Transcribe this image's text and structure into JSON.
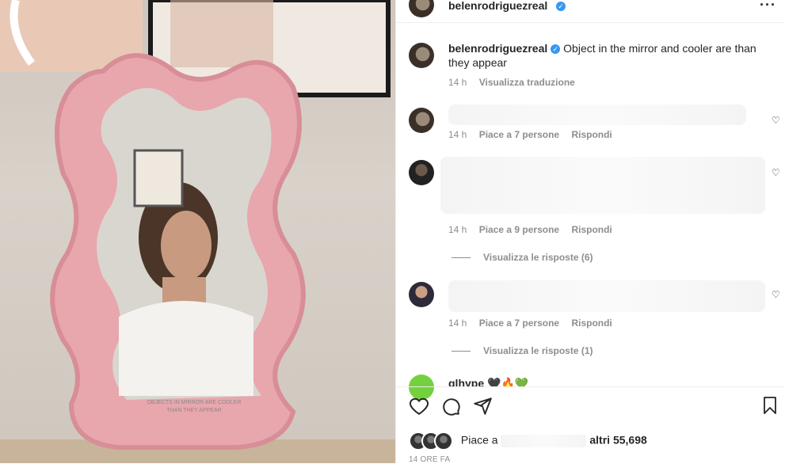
{
  "post": {
    "username": "belenrodriguezreal",
    "more_icon": "more-horizontal-icon"
  },
  "caption": {
    "username": "belenrodriguezreal",
    "text": "Object in the mirror and cooler are than they appear",
    "time": "14 h",
    "translate": "Visualizza traduzione"
  },
  "comments": [
    {
      "time": "14 h",
      "likes": "Piace a 7 persone",
      "reply": "Rispondi",
      "view_replies": ""
    },
    {
      "time": "14 h",
      "likes": "Piace a 9 persone",
      "reply": "Rispondi",
      "view_replies": "Visualizza le risposte (6)"
    },
    {
      "time": "14 h",
      "likes": "Piace a 7 persone",
      "reply": "Rispondi",
      "view_replies": "Visualizza le risposte (1)"
    }
  ],
  "partial_comment": {
    "username": "glhype",
    "emoji": "🖤🔥💚"
  },
  "likes": {
    "prefix": "Piace a",
    "suffix": "altri 55,698"
  },
  "timestamp": "14 ORE FA",
  "mirror_text": "OBJECTS IN MIRROR ARE COOLER THAN THEY APPEAR",
  "colors": {
    "accent": "#3897f0",
    "mirror_frame": "#e8a6ad",
    "muted": "#8e8e8e"
  }
}
